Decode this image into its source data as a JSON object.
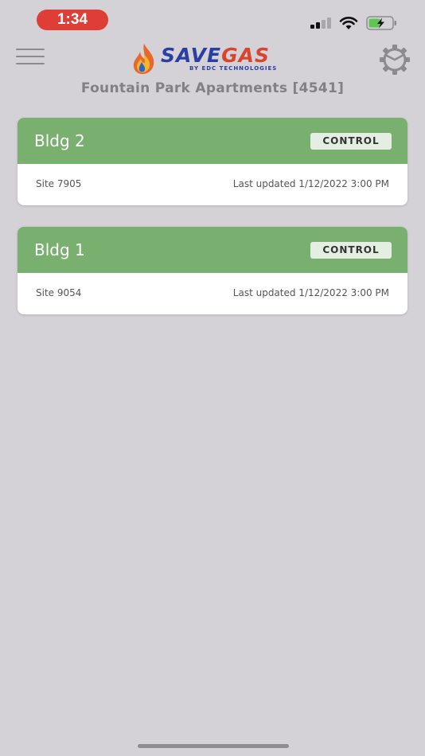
{
  "status_bar": {
    "time": "1:34",
    "time_pill_color": "#de3e35",
    "signal_icon": "cellular-signal-icon",
    "wifi_icon": "wifi-icon",
    "battery_icon": "battery-charging-icon"
  },
  "header": {
    "menu_icon": "hamburger-menu-icon",
    "logo": {
      "brand_save": "SAVE",
      "brand_gas": "GAS",
      "tagline": "BY EDC TECHNOLOGIES",
      "save_color": "#2b3fa3",
      "gas_color": "#d8452f"
    },
    "settings_icon": "gear-icon",
    "page_title": "Fountain Park Apartments [4541]"
  },
  "buildings": [
    {
      "name": "Bldg 2",
      "action_label": "CONTROL",
      "site": "Site 7905",
      "last_updated": "Last updated 1/12/2022 3:00 PM"
    },
    {
      "name": "Bldg 1",
      "action_label": "CONTROL",
      "site": "Site 9054",
      "last_updated": "Last updated 1/12/2022 3:00 PM"
    }
  ],
  "colors": {
    "background": "#d4d2d7",
    "card_header": "#7ab06f",
    "control_button_bg": "#e5eee3"
  }
}
